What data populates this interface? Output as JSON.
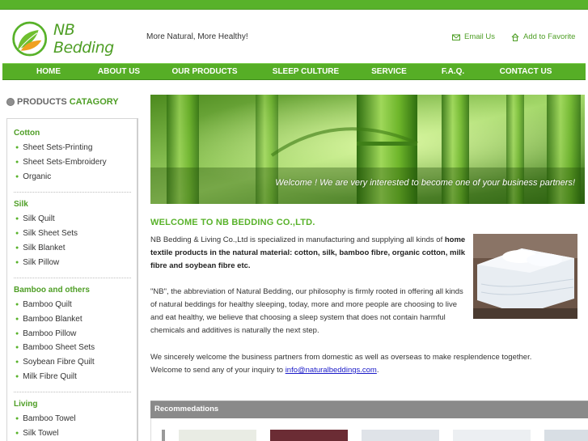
{
  "brand": {
    "name": "NB Bedding",
    "slogan": "More Natural, More Healthy!"
  },
  "toplinks": {
    "email": "Email Us",
    "favorite": "Add to Favorite"
  },
  "nav": [
    "HOME",
    "ABOUT US",
    "OUR PRODUCTS",
    "SLEEP CULTURE",
    "SERVICE",
    "F.A.Q.",
    "CONTACT US"
  ],
  "sidebar": {
    "title_a": "PRODUCTS",
    "title_b": "CATAGORY",
    "categories": [
      {
        "name": "Cotton",
        "items": [
          "Sheet Sets-Printing",
          "Sheet Sets-Embroidery",
          "Organic"
        ]
      },
      {
        "name": "Silk",
        "items": [
          "Silk Quilt",
          "Silk Sheet Sets",
          "Silk Blanket",
          "Silk Pillow"
        ]
      },
      {
        "name": "Bamboo and others",
        "items": [
          "Bamboo Quilt",
          "Bamboo Blanket",
          "Bamboo Pillow",
          "Bamboo Sheet Sets",
          "Soybean Fibre Quilt",
          "Milk Fibre Quilt"
        ]
      },
      {
        "name": "Living",
        "items": [
          "Bamboo Towel",
          "Silk Towel"
        ]
      }
    ]
  },
  "banner": {
    "caption": "Welcome ! We are very interested to become one of your business partners!"
  },
  "welcome": {
    "title": "WELCOME TO NB BEDDING CO.,LTD.",
    "p1_plain": "NB Bedding & Living Co.,Ltd is specialized in manufacturing and supplying all kinds of",
    "p1_bold": "home textile products in the natural material: cotton, silk, bamboo fibre, organic cotton, milk fibre and soybean fibre etc.",
    "p2": "\"NB\", the abbreviation of Natural Bedding, our philosophy is firmly rooted in offering all kinds of natural beddings for healthy sleeping, today, more and more people are choosing to live and eat healthy, we believe that choosing a sleep system that does not contain harmful chemicals and additives is naturally the next step.",
    "p3_a": "We sincerely welcome the business partners from domestic as well as overseas to make resplendence together.",
    "p3_b": "Welcome to send any of your inquiry to",
    "email": "info@naturalbeddings.com",
    "p3_end": "."
  },
  "recommend": {
    "title": "Recommedations"
  },
  "colors": {
    "brand_green": "#58b22a",
    "title_green": "#4e9e25",
    "rec_bar": "#8a8a8a"
  }
}
